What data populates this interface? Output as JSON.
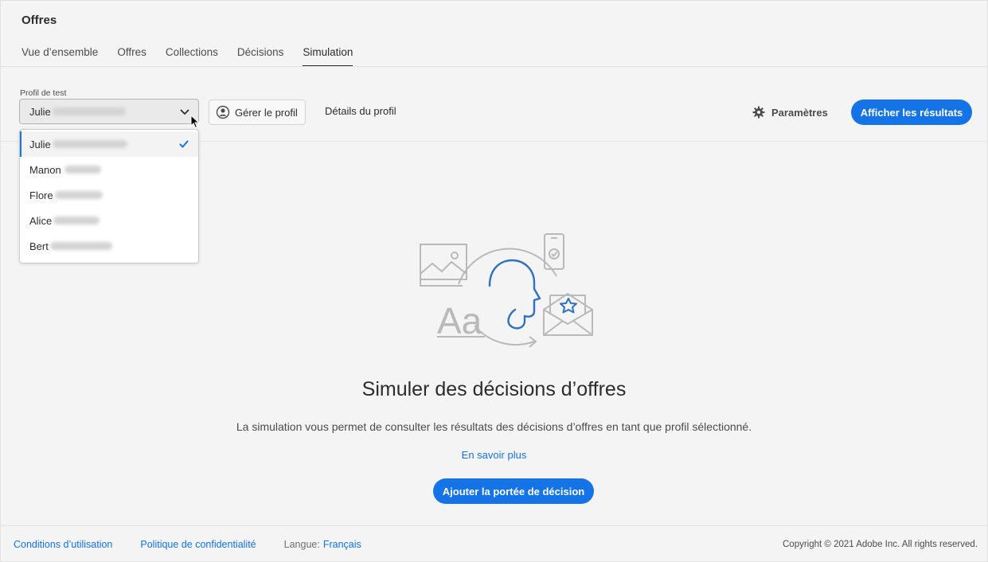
{
  "header": {
    "title": "Offres"
  },
  "tabs": [
    {
      "label": "Vue d’ensemble"
    },
    {
      "label": "Offres"
    },
    {
      "label": "Collections"
    },
    {
      "label": "Décisions"
    },
    {
      "label": "Simulation",
      "active": true
    }
  ],
  "toolbar": {
    "profile_label": "Profil de test",
    "selected_profile": "Julie",
    "manage_profile_label": "Gérer le profil",
    "profile_details_label": "Détails du profil",
    "settings_label": "Paramètres",
    "show_results_label": "Afficher les résultats"
  },
  "dropdown": {
    "items": [
      {
        "label": "Julie",
        "selected": true
      },
      {
        "label": "Manon"
      },
      {
        "label": "Flore"
      },
      {
        "label": "Alice"
      },
      {
        "label": "Bert"
      }
    ]
  },
  "empty_state": {
    "illustration_text": "Aa",
    "title": "Simuler des décisions d’offres",
    "description": "La simulation vous permet de consulter les résultats des décisions d’offres en tant que profil sélectionné.",
    "learn_more": "En savoir plus",
    "add_scope_label": "Ajouter la portée de décision"
  },
  "footer": {
    "terms": "Conditions d’utilisation",
    "privacy": "Politique de confidentialité",
    "language_label": "Langue:",
    "language_value": "Français",
    "copyright": "Copyright ©  2021 Adobe Inc.  All rights reserved."
  },
  "colors": {
    "accent": "#1473e6",
    "background": "#f4f4f4",
    "text": "#2c2c2c"
  }
}
